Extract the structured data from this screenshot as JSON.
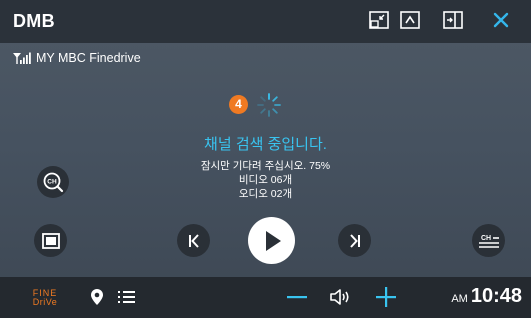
{
  "app": {
    "title": "DMB"
  },
  "station": {
    "name": "MY MBC Finedrive",
    "signal_icon": "signal-bars-icon"
  },
  "search": {
    "badge_count": "4",
    "title": "채널 검색 중입니다.",
    "progress_text": "잠시만 기다려 주십시오. 75%",
    "progress": 0.75,
    "video_count": "비디오 06개",
    "audio_count": "오디오 02개"
  },
  "toolbar": {
    "icons": [
      "minimize-window-icon",
      "collapse-up-icon",
      "split-screen-icon",
      "close-icon"
    ]
  },
  "controls": {
    "ch_search_icon": "channel-search-icon",
    "screen_mode_icon": "screen-mode-icon",
    "prev_icon": "previous-channel-icon",
    "play_icon": "play-icon",
    "next_icon": "next-channel-icon",
    "ch_list_icon": "channel-list-icon",
    "ch_label": "CH"
  },
  "bottom": {
    "logo_line1": "FINE",
    "logo_line2": "DriVe",
    "time_ampm": "AM",
    "time": "10:48"
  },
  "colors": {
    "accent": "#39c4f0",
    "badge": "#f07a22",
    "logo": "#f07a22",
    "close": "#34b6ea",
    "title_bar": "#2b323a",
    "bottom_bar": "#24292f"
  }
}
